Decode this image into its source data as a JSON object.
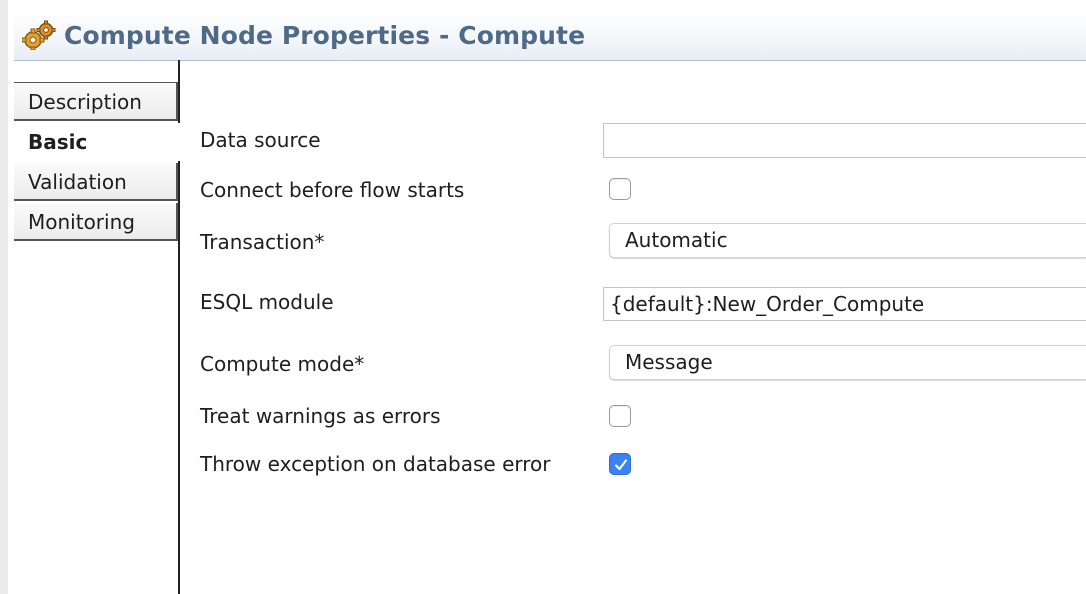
{
  "header": {
    "title": "Compute Node Properties - Compute",
    "icon": "gears-icon"
  },
  "tabs": [
    {
      "label": "Description",
      "active": false
    },
    {
      "label": "Basic",
      "active": true
    },
    {
      "label": "Validation",
      "active": false
    },
    {
      "label": "Monitoring",
      "active": false
    }
  ],
  "form": {
    "data_source": {
      "label": "Data source",
      "value": ""
    },
    "connect_before_flow": {
      "label": "Connect before flow starts",
      "checked": false
    },
    "transaction": {
      "label": "Transaction*",
      "value": "Automatic"
    },
    "esql_module": {
      "label": "ESQL module",
      "value": "{default}:New_Order_Compute"
    },
    "compute_mode": {
      "label": "Compute mode*",
      "value": "Message"
    },
    "treat_warnings": {
      "label": "Treat warnings as errors",
      "checked": false
    },
    "throw_exception": {
      "label": "Throw exception on database error",
      "checked": true
    }
  },
  "colors": {
    "title": "#4f6a86",
    "checkbox_checked": "#3a82f6",
    "header_border": "#aebfd3"
  }
}
